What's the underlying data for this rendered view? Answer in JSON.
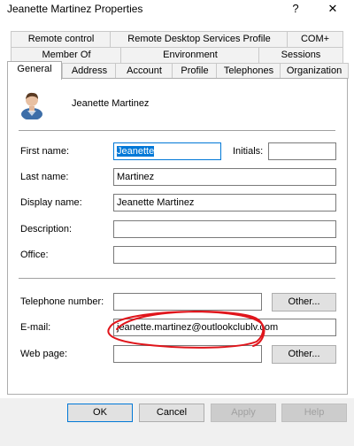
{
  "window": {
    "title": "Jeanette Martinez Properties",
    "help_glyph": "?",
    "close_glyph": "✕"
  },
  "tabs": {
    "row1": [
      "Remote control",
      "Remote Desktop Services Profile",
      "COM+"
    ],
    "row2": [
      "Member Of",
      "Environment",
      "Sessions"
    ],
    "row3": [
      "General",
      "Address",
      "Account",
      "Profile",
      "Telephones",
      "Organization"
    ],
    "active": "General"
  },
  "user": {
    "display": "Jeanette Martinez",
    "icon": "user-avatar-icon"
  },
  "fields": {
    "first_name": {
      "label": "First name:",
      "value": "Jeanette"
    },
    "initials": {
      "label": "Initials:",
      "value": ""
    },
    "last_name": {
      "label": "Last name:",
      "value": "Martinez"
    },
    "display_name": {
      "label": "Display name:",
      "value": "Jeanette Martinez"
    },
    "description": {
      "label": "Description:",
      "value": ""
    },
    "office": {
      "label": "Office:",
      "value": ""
    },
    "telephone": {
      "label": "Telephone number:",
      "value": ""
    },
    "email": {
      "label": "E-mail:",
      "value": "jeanette.martinez@outlookclublv.com"
    },
    "web_page": {
      "label": "Web page:",
      "value": ""
    }
  },
  "buttons": {
    "other_phone": "Other...",
    "other_web": "Other...",
    "ok": "OK",
    "cancel": "Cancel",
    "apply": "Apply",
    "help": "Help"
  },
  "annotation": {
    "color": "#e0151b"
  }
}
